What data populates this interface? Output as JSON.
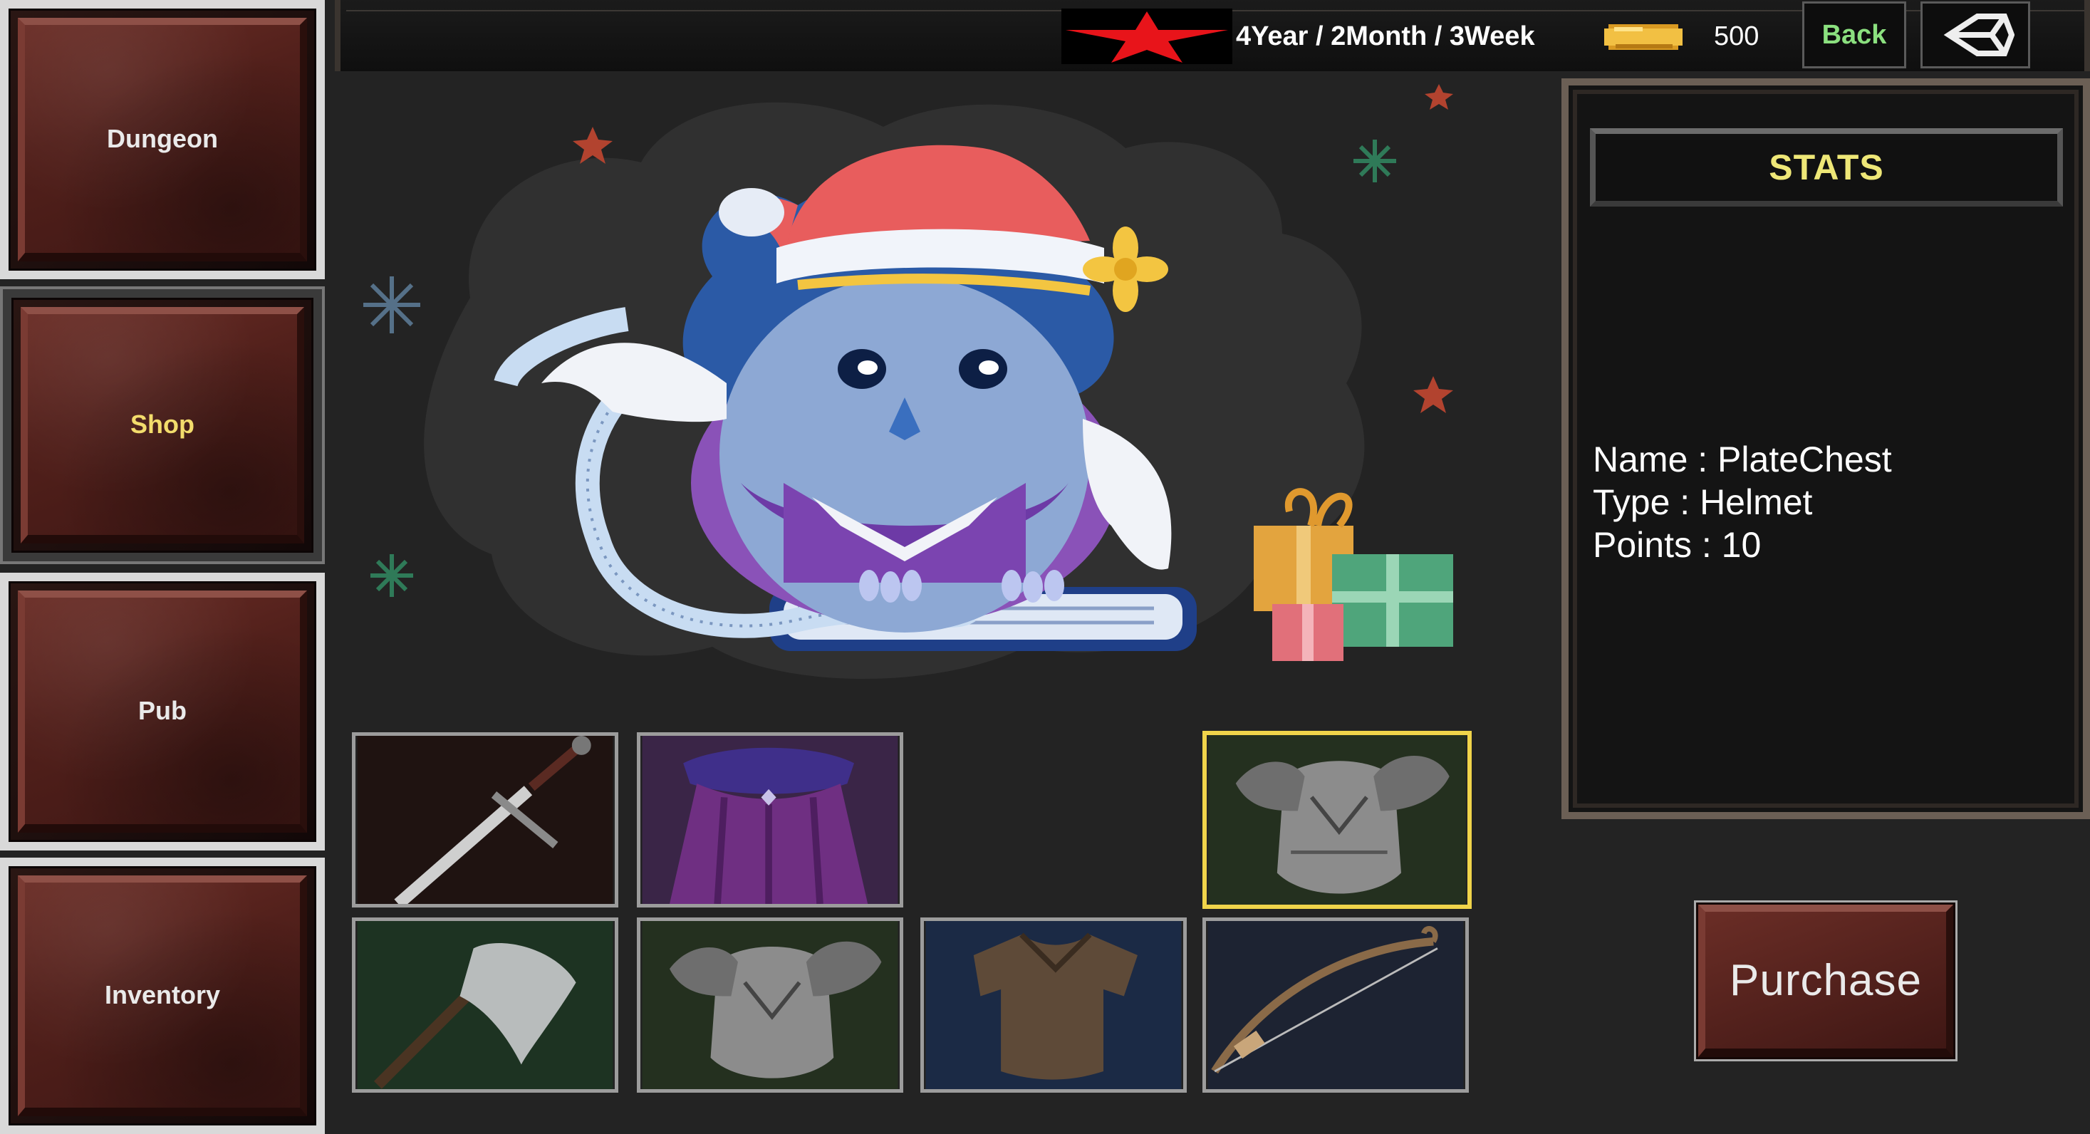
{
  "nav": {
    "items": [
      {
        "label": "Dungeon",
        "active": false
      },
      {
        "label": "Shop",
        "active": true
      },
      {
        "label": "Pub",
        "active": false
      },
      {
        "label": "Inventory",
        "active": false
      }
    ]
  },
  "topbar": {
    "date": "4Year / 2Month / 3Week",
    "gold": "500",
    "back_label": "Back",
    "star_color": "#e8141a",
    "coin_color": "#f2c043",
    "back_color": "#8be07f"
  },
  "showcase": {
    "image": "owl-mascot-santa-hat-tape-measure",
    "icons": [
      "santa-hat",
      "tape-measure",
      "book",
      "gift-boxes",
      "sparkle-stars"
    ]
  },
  "items": [
    {
      "name": "sword",
      "selected": false
    },
    {
      "name": "purple-cloak",
      "selected": false
    },
    {
      "name": "empty",
      "selected": false
    },
    {
      "name": "plate-chest",
      "selected": true
    },
    {
      "name": "axe",
      "selected": false
    },
    {
      "name": "plate-chest",
      "selected": false
    },
    {
      "name": "leather-armor",
      "selected": false
    },
    {
      "name": "bow",
      "selected": false
    }
  ],
  "stats": {
    "title": "STATS",
    "name_line": "Name : PlateChest",
    "type_line": "Type : Helmet",
    "points_line": "Points : 10",
    "title_color": "#eee777"
  },
  "purchase": {
    "label": "Purchase"
  },
  "colors": {
    "background": "#232323",
    "stone_red": "#52201b",
    "selected_border": "#f0d44a",
    "active_nav_text": "#f3dc6c"
  }
}
